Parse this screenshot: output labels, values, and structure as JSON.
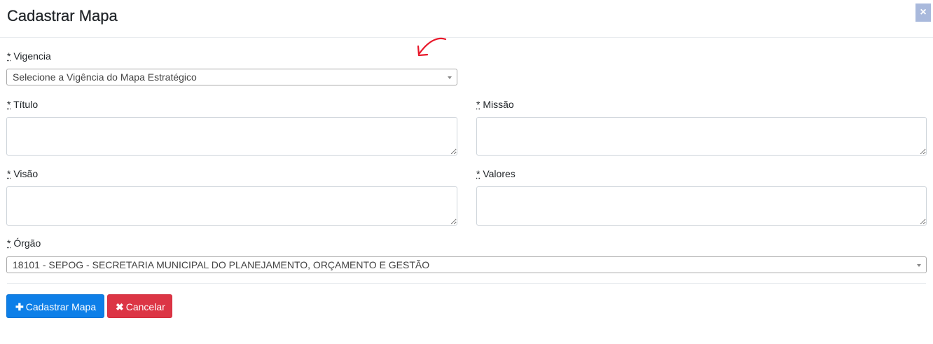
{
  "modal": {
    "title": "Cadastrar Mapa",
    "close_symbol": "×"
  },
  "form": {
    "required_marker": "*",
    "vigencia": {
      "label": "Vigencia",
      "selected": "Selecione a Vigência do Mapa Estratégico"
    },
    "titulo": {
      "label": "Título",
      "value": ""
    },
    "missao": {
      "label": "Missão",
      "value": ""
    },
    "visao": {
      "label": "Visão",
      "value": ""
    },
    "valores": {
      "label": "Valores",
      "value": ""
    },
    "orgao": {
      "label": "Órgão",
      "selected": "18101 - SEPOG - SECRETARIA MUNICIPAL DO PLANEJAMENTO, ORÇAMENTO E GESTÃO"
    }
  },
  "buttons": {
    "submit": {
      "icon": "plus-icon",
      "glyph": "✚",
      "label": "Cadastrar Mapa",
      "color": "#0d7fe8"
    },
    "cancel": {
      "icon": "times-icon",
      "glyph": "✖",
      "label": "Cancelar",
      "color": "#dc3545"
    }
  },
  "annotation": {
    "icon": "red-arrow-annotation",
    "color": "#e8182a"
  }
}
